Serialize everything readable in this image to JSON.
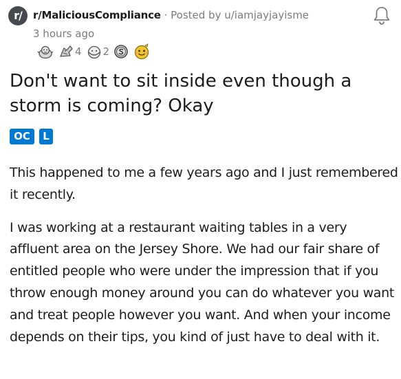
{
  "header": {
    "subreddit_icon_text": "r/",
    "subreddit": "r/MaliciousCompliance",
    "separator": "·",
    "posted_by": "Posted by u/iamjayjayisme",
    "time": "3 hours ago"
  },
  "awards": [
    {
      "icon": "wholesome-seal-award-icon",
      "count": ""
    },
    {
      "icon": "bravo-award-icon",
      "count": "4"
    },
    {
      "icon": "hugz-award-icon",
      "count": "2"
    },
    {
      "icon": "silver-s-award-icon",
      "count": ""
    },
    {
      "icon": "wholesome-award-icon",
      "count": ""
    }
  ],
  "post": {
    "title": "Don't want to sit inside even though a storm is coming? Okay",
    "flairs": [
      "OC",
      "L"
    ],
    "paragraphs": [
      "This happened to me a few years ago and I just remembered it recently.",
      "I was working at a restaurant waiting tables in a very affluent area on the Jersey Shore.  We had our fair share of entitled people who were under the impression that if you throw enough money around you can do whatever you want and treat people however you want.  And when your income depends on their tips, you kind of just have to deal with it."
    ]
  },
  "colors": {
    "flair_bg": "#0079d3",
    "meta_gray": "#7c7c7c",
    "text": "#1c1c1c",
    "avatar_bg": "#46494d"
  }
}
